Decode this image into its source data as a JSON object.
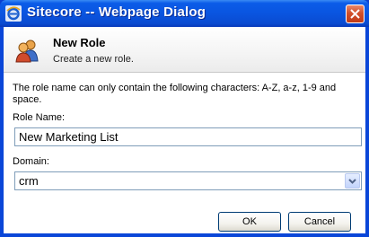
{
  "window": {
    "title": "Sitecore -- Webpage Dialog"
  },
  "header": {
    "title": "New Role",
    "subtitle": "Create a new role."
  },
  "form": {
    "description": "The role name can only contain the following characters: A-Z, a-z, 1-9 and space.",
    "role_name_label": "Role Name:",
    "role_name_value": "New Marketing List",
    "domain_label": "Domain:",
    "domain_value": "crm"
  },
  "buttons": {
    "ok_label": "OK",
    "cancel_label": "Cancel"
  },
  "icons": {
    "title": "internet-explorer-icon",
    "header": "users-role-icon",
    "close": "close-icon",
    "dropdown": "chevron-down-icon"
  },
  "colors": {
    "titlebar": "#0a55e0",
    "close_button": "#d1502a",
    "input_border": "#7f9db9"
  }
}
